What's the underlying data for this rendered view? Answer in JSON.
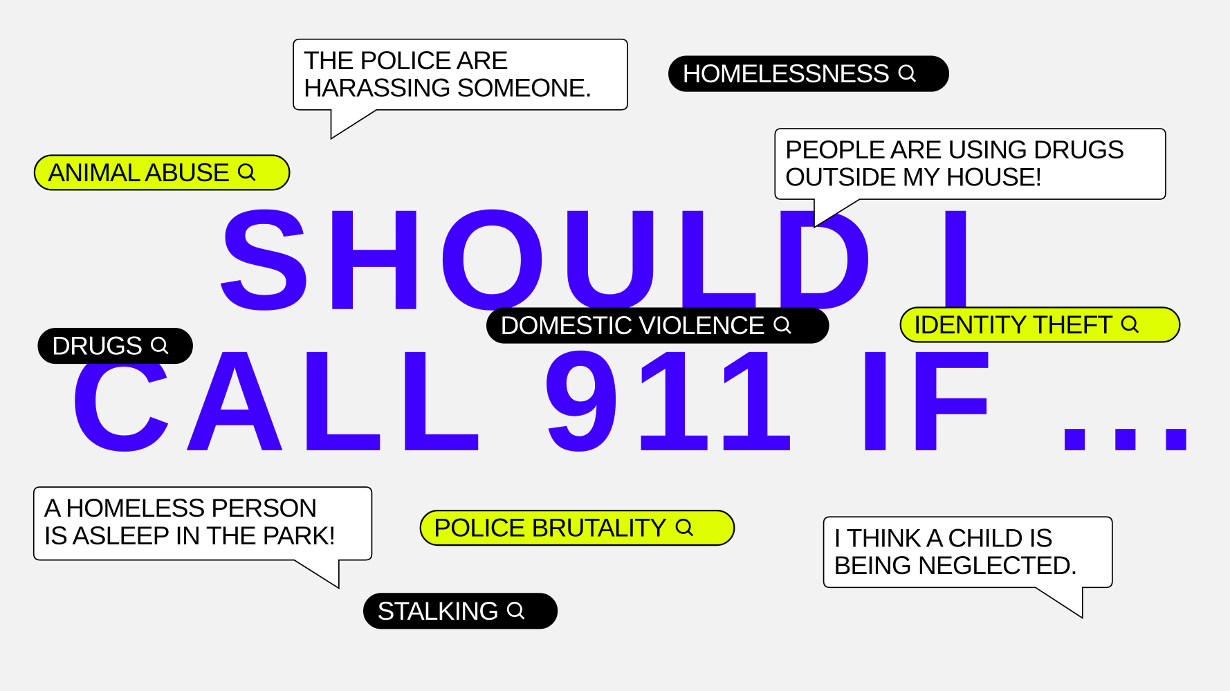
{
  "headline": {
    "line1": "SHOULD I",
    "line2": "CALL 911 IF ..."
  },
  "colors": {
    "background": "#f2f2f2",
    "headline": "#4000ff",
    "lime": "#dfff00",
    "black": "#000000"
  },
  "bubbles": [
    {
      "line1": "THE POLICE ARE",
      "line2": "HARASSING SOMEONE."
    },
    {
      "line1": "PEOPLE ARE USING DRUGS",
      "line2": "OUTSIDE MY HOUSE!"
    },
    {
      "line1": "A HOMELESS PERSON",
      "line2": "IS ASLEEP IN THE PARK!"
    },
    {
      "line1": "I THINK A CHILD IS",
      "line2": "BEING NEGLECTED."
    }
  ],
  "search_pills": [
    {
      "label": "HOMELESSNESS",
      "style": "black",
      "icon": "search-icon"
    },
    {
      "label": "ANIMAL ABUSE",
      "style": "lime",
      "icon": "search-icon"
    },
    {
      "label": "DOMESTIC VIOLENCE",
      "style": "black",
      "icon": "search-icon"
    },
    {
      "label": "IDENTITY THEFT",
      "style": "lime",
      "icon": "search-icon"
    },
    {
      "label": "DRUGS",
      "style": "black",
      "icon": "search-icon"
    },
    {
      "label": "POLICE BRUTALITY",
      "style": "lime",
      "icon": "search-icon"
    },
    {
      "label": "STALKING",
      "style": "black",
      "icon": "search-icon"
    }
  ]
}
